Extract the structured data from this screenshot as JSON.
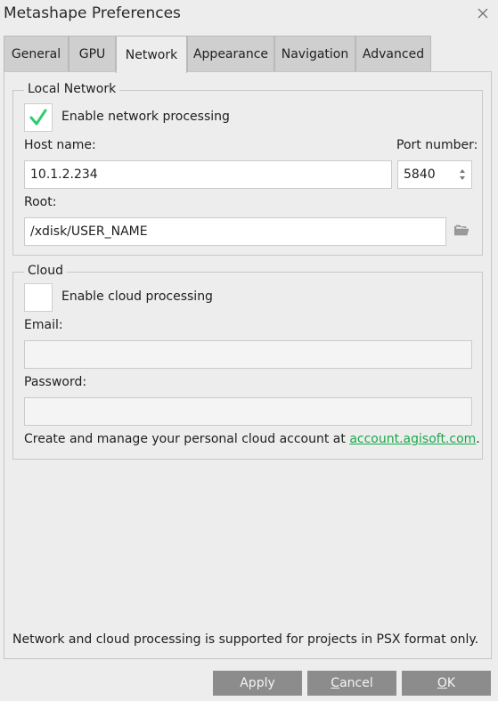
{
  "window": {
    "title": "Metashape Preferences",
    "close_icon": "close-icon"
  },
  "tabs": [
    {
      "label": "General"
    },
    {
      "label": "GPU"
    },
    {
      "label": "Network",
      "active": true
    },
    {
      "label": "Appearance"
    },
    {
      "label": "Navigation"
    },
    {
      "label": "Advanced"
    }
  ],
  "local_network": {
    "title": "Local Network",
    "enable_label": "Enable network processing",
    "enabled": true,
    "host_label": "Host name:",
    "host_value": "10.1.2.234",
    "port_label": "Port number:",
    "port_value": "5840",
    "root_label": "Root:",
    "root_value": "/xdisk/USER_NAME",
    "browse_icon": "folder-icon"
  },
  "cloud": {
    "title": "Cloud",
    "enable_label": "Enable cloud processing",
    "enabled": false,
    "email_label": "Email:",
    "email_value": "",
    "password_label": "Password:",
    "password_value": "",
    "account_text": "Create and manage your personal cloud account at ",
    "account_link": "account.agisoft.com",
    "account_suffix": "."
  },
  "footer_note": "Network and cloud processing is supported for projects in PSX format only.",
  "buttons": {
    "apply": "Apply",
    "cancel_prefix": "",
    "cancel_underlined": "C",
    "cancel_rest": "ancel",
    "ok_underlined": "O",
    "ok_rest": "K"
  },
  "colors": {
    "checkmark": "#2ecc71",
    "link": "#1aa84a",
    "button_bg": "#8c8c8c"
  }
}
